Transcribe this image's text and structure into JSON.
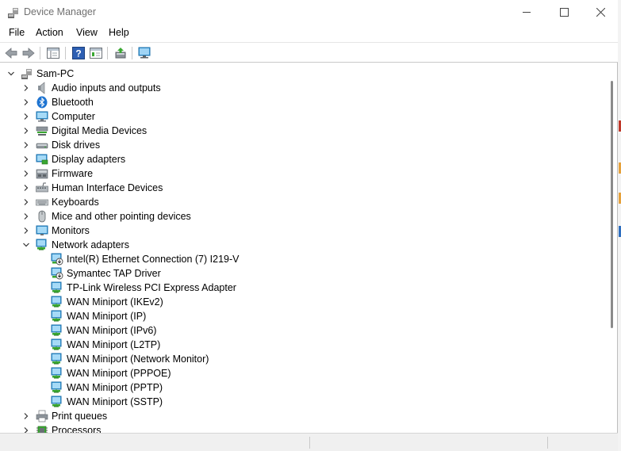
{
  "window": {
    "title": "Device Manager"
  },
  "menu": [
    "File",
    "Action",
    "View",
    "Help"
  ],
  "icons": {
    "toolbar": [
      "back-icon",
      "forward-icon",
      "show-hide-tree-icon",
      "help-icon",
      "properties-icon",
      "update-driver-icon",
      "scan-hardware-icon"
    ]
  },
  "tree": {
    "root": {
      "label": "Sam-PC",
      "expanded": true
    },
    "categories": [
      {
        "label": "Audio inputs and outputs",
        "icon": "speaker-icon",
        "expanded": false
      },
      {
        "label": "Bluetooth",
        "icon": "bluetooth-icon",
        "expanded": false
      },
      {
        "label": "Computer",
        "icon": "computer-icon",
        "expanded": false
      },
      {
        "label": "Digital Media Devices",
        "icon": "media-device-icon",
        "expanded": false
      },
      {
        "label": "Disk drives",
        "icon": "disk-drive-icon",
        "expanded": false
      },
      {
        "label": "Display adapters",
        "icon": "display-adapter-icon",
        "expanded": false
      },
      {
        "label": "Firmware",
        "icon": "firmware-icon",
        "expanded": false
      },
      {
        "label": "Human Interface Devices",
        "icon": "hid-icon",
        "expanded": false
      },
      {
        "label": "Keyboards",
        "icon": "keyboard-icon",
        "expanded": false
      },
      {
        "label": "Mice and other pointing devices",
        "icon": "mouse-icon",
        "expanded": false
      },
      {
        "label": "Monitors",
        "icon": "monitor-icon",
        "expanded": false
      },
      {
        "label": "Network adapters",
        "icon": "network-adapter-icon",
        "expanded": true
      },
      {
        "label": "Print queues",
        "icon": "printer-icon",
        "expanded": false
      },
      {
        "label": "Processors",
        "icon": "processor-icon",
        "expanded": false
      }
    ],
    "network_adapters": [
      {
        "label": "Intel(R) Ethernet Connection (7) I219-V",
        "icon": "network-disabled-icon"
      },
      {
        "label": "Symantec TAP Driver",
        "icon": "network-disabled-icon"
      },
      {
        "label": "TP-Link Wireless PCI Express Adapter",
        "icon": "network-adapter-icon"
      },
      {
        "label": "WAN Miniport (IKEv2)",
        "icon": "network-adapter-icon"
      },
      {
        "label": "WAN Miniport (IP)",
        "icon": "network-adapter-icon"
      },
      {
        "label": "WAN Miniport (IPv6)",
        "icon": "network-adapter-icon"
      },
      {
        "label": "WAN Miniport (L2TP)",
        "icon": "network-adapter-icon"
      },
      {
        "label": "WAN Miniport (Network Monitor)",
        "icon": "network-adapter-icon"
      },
      {
        "label": "WAN Miniport (PPPOE)",
        "icon": "network-adapter-icon"
      },
      {
        "label": "WAN Miniport (PPTP)",
        "icon": "network-adapter-icon"
      },
      {
        "label": "WAN Miniport (SSTP)",
        "icon": "network-adapter-icon"
      }
    ]
  },
  "colors": {
    "accent": "#1e8fd6",
    "network_green": "#3aa832"
  }
}
